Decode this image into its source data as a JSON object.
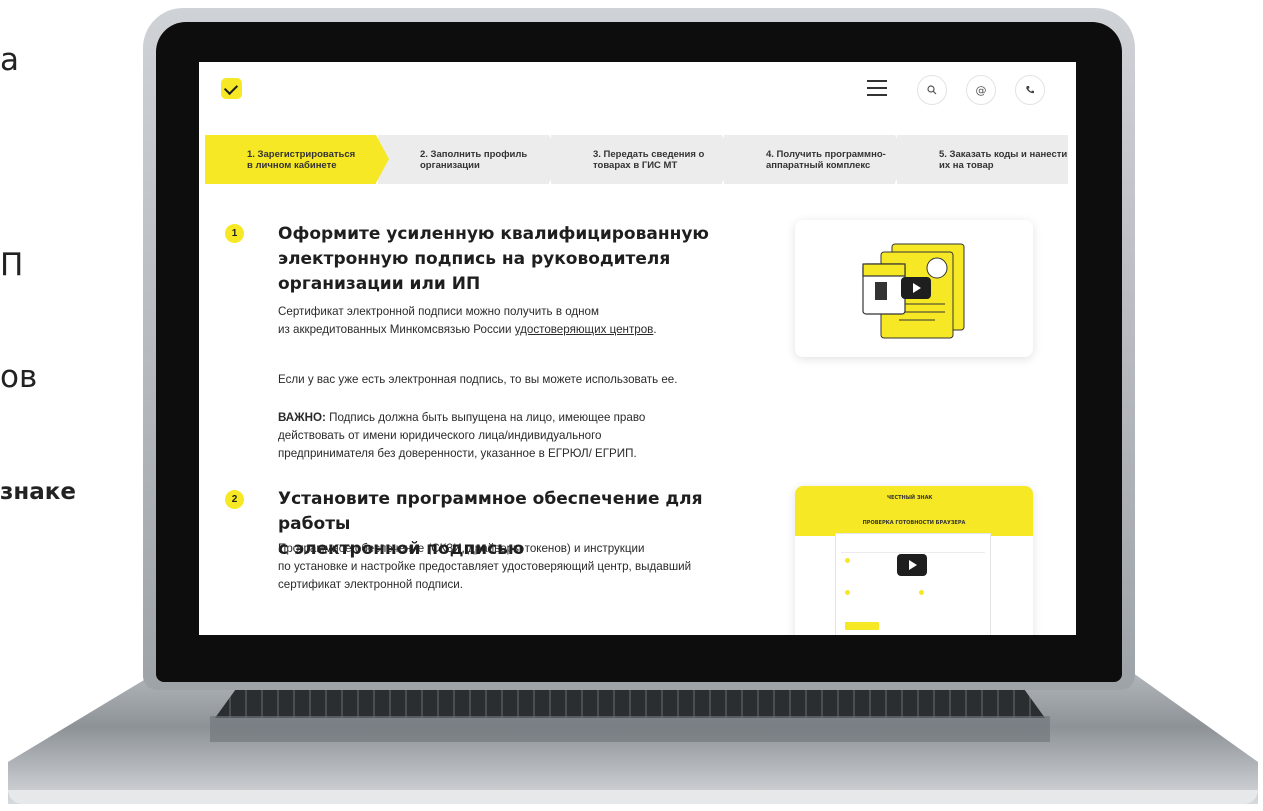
{
  "slide_fragments": [
    "а",
    "П",
    "ов",
    "знаке"
  ],
  "header": {
    "logo_icon": "check-mark-icon",
    "menu_icon": "hamburger-icon",
    "search_icon": "search-icon",
    "email_icon": "at-sign-icon",
    "phone_icon": "phone-icon"
  },
  "steps": [
    {
      "line1": "1. Зарегистрироваться",
      "line2": "в личном кабинете",
      "active": true
    },
    {
      "line1": "2. Заполнить профиль",
      "line2": "организации",
      "active": false
    },
    {
      "line1": "3. Передать сведения о",
      "line2": "товарах в ГИС МТ",
      "active": false
    },
    {
      "line1": "4. Получить программно-",
      "line2": "аппаратный комплекс",
      "active": false
    },
    {
      "line1": "5. Заказать коды и нанести",
      "line2": "их на товар",
      "active": false
    }
  ],
  "section1": {
    "number": "1",
    "title_line1": "Оформите усиленную квалифицированную",
    "title_line2": "электронную подпись на руководителя",
    "title_line3": "организации или ИП",
    "p1_line1": "Сертификат электронной подписи можно получить в одном",
    "p1_line2_prefix": "из аккредитованных Минкомсвязью России ",
    "p1_link": "удостоверяющих центров",
    "p1_line2_suffix": ".",
    "p2": "Если у вас уже есть электронная подпись, то вы можете использовать ее.",
    "p3_bold": "ВАЖНО:",
    "p3_line1": " Подпись должна быть выпущена на лицо, имеющее право",
    "p3_line2": "действовать от имени юридического лица/индивидуального",
    "p3_line3": "предпринимателя без доверенности, указанное в ЕГРЮЛ/ ЕГРИП."
  },
  "section2": {
    "number": "2",
    "title_line1": "Установите программное обеспечение для работы",
    "title_line2": "с электронной подписью",
    "p1_line1": "Программное обеспечение (СКЗИ, драйверы токенов) и инструкции",
    "p1_line2": "по установке и настройке предоставляет удостоверяющий центр, выдавший",
    "p1_line3": "сертификат электронной подписи."
  },
  "video2": {
    "brand": "ЧЕСТНЫЙ ЗНАК",
    "title": "ПРОВЕРКА ГОТОВНОСТИ БРАУЗЕРА"
  },
  "colors": {
    "accent": "#f6e824",
    "text": "#1e1e1e",
    "step_bg": "#ececec"
  }
}
